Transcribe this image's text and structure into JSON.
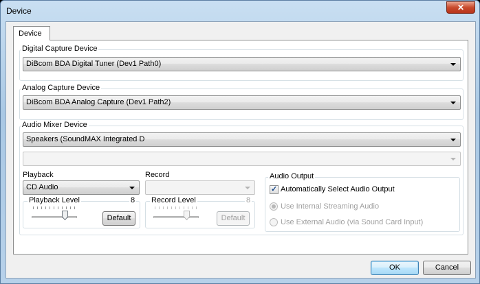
{
  "window": {
    "title": "Device",
    "close_glyph": "✕"
  },
  "tabs": [
    {
      "label": "Device"
    }
  ],
  "digital": {
    "label": "Digital Capture Device",
    "selected": "DiBcom BDA Digital Tuner (Dev1 Path0)"
  },
  "analog": {
    "label": "Analog Capture Device",
    "selected": "DiBcom BDA Analog Capture (Dev1 Path2)"
  },
  "mixer": {
    "label": "Audio Mixer Device",
    "selected": "Speakers (SoundMAX Integrated D",
    "secondary": ""
  },
  "playback": {
    "label": "Playback",
    "selected": "CD Audio",
    "level_label": "Playback Level",
    "level_value": "8",
    "level_fraction": 0.8,
    "default_label": "Default"
  },
  "record": {
    "label": "Record",
    "selected": "",
    "level_label": "Record Level",
    "level_value": "8",
    "level_fraction": 0.8,
    "default_label": "Default"
  },
  "audio_output": {
    "label": "Audio Output",
    "auto_select": {
      "label": "Automatically Select Audio Output",
      "checked": true
    },
    "internal": {
      "label": "Use Internal Streaming Audio",
      "selected": true
    },
    "external": {
      "label": "Use External Audio (via Sound Card Input)",
      "selected": false
    }
  },
  "buttons": {
    "ok": "OK",
    "cancel": "Cancel"
  }
}
